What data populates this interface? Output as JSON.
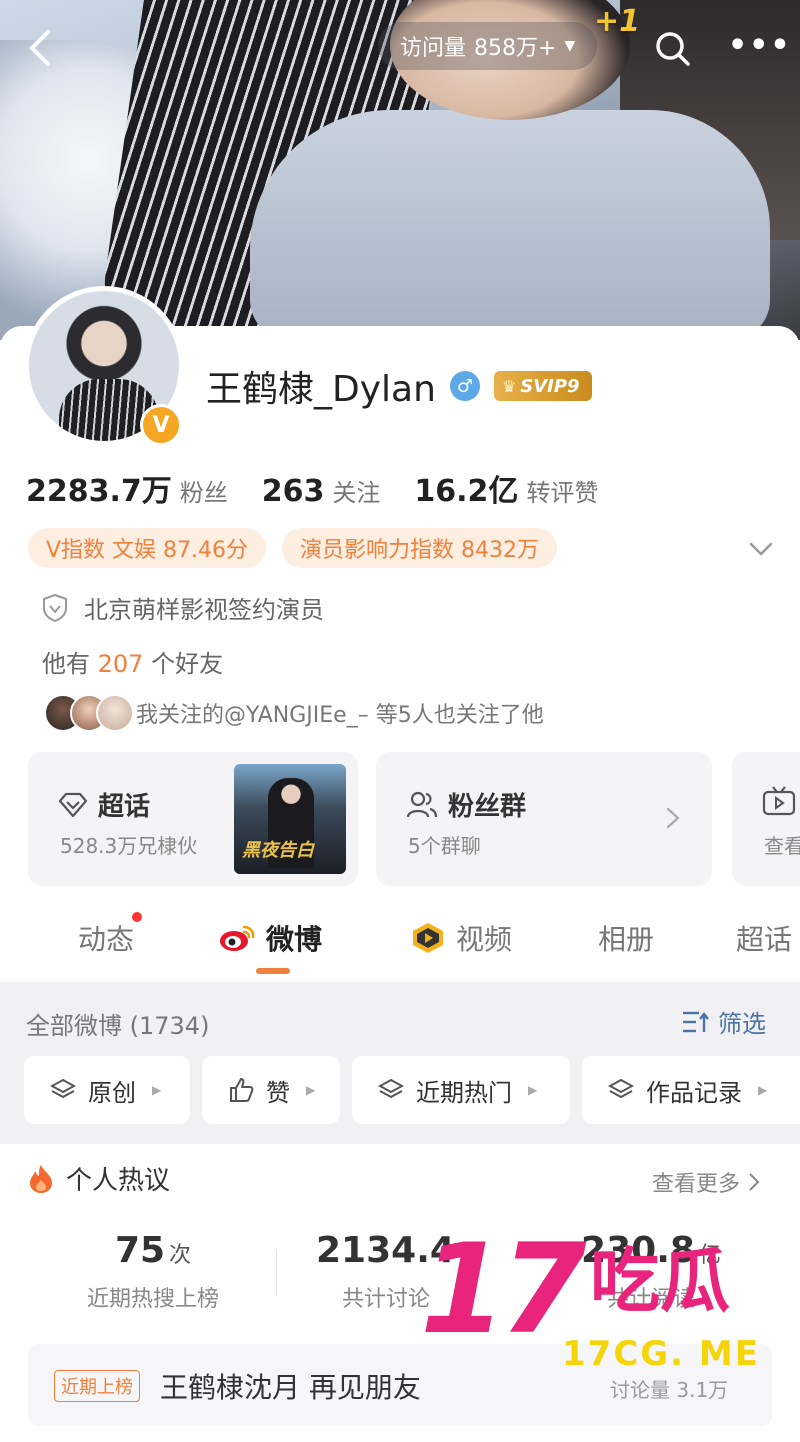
{
  "header": {
    "visits_label": "访问量",
    "visits_value": "858万+",
    "plus_one": "+1"
  },
  "profile": {
    "name": "王鹤棣_Dylan",
    "gender_icon": "male-icon",
    "vip_badge": "SVIP9",
    "verified_badge": "V",
    "stats": [
      {
        "value": "2283.7万",
        "label": "粉丝"
      },
      {
        "value": "263",
        "label": "关注"
      },
      {
        "value": "16.2亿",
        "label": "转评赞"
      }
    ],
    "chips": [
      "V指数 文娱 87.46分",
      "演员影响力指数 8432万"
    ],
    "verification": "北京萌样影视签约演员",
    "friends_prefix": "他有",
    "friends_count": "207",
    "friends_suffix": "个好友",
    "mutual_text": "我关注的@YANGJIEe_– 等5人也关注了他"
  },
  "feature_cards": [
    {
      "title": "超话",
      "subtitle": "528.3万兄棣伙",
      "thumb_text": "黑夜告白"
    },
    {
      "title": "粉丝群",
      "subtitle": "5个群聊"
    },
    {
      "title": "",
      "subtitle": "查看"
    }
  ],
  "tabs": [
    {
      "label": "动态",
      "has_dot": true
    },
    {
      "label": "微博",
      "active": true
    },
    {
      "label": "视频"
    },
    {
      "label": "相册"
    },
    {
      "label": "超话"
    }
  ],
  "feed": {
    "all_label": "全部微博 (1734)",
    "filter_label": "筛选",
    "pills": [
      "原创",
      "赞",
      "近期热门",
      "作品记录"
    ]
  },
  "hot": {
    "title": "个人热议",
    "more": "查看更多",
    "metrics": [
      {
        "value": "75",
        "unit": "次",
        "label": "近期热搜上榜"
      },
      {
        "value": "2134.4",
        "unit": "",
        "label": "共计讨论"
      },
      {
        "value": "230.8",
        "unit": "亿",
        "label": "共计阅读"
      }
    ],
    "trend_tag": "近期上榜",
    "trend_title": "王鹤棣沈月 再见朋友",
    "trend_value": "讨论量 3.1万"
  },
  "watermark": {
    "big": "17",
    "cn": "吃瓜",
    "url": "17CG. ME"
  },
  "colors": {
    "accent_orange": "#f0803c",
    "link_blue": "#4a74a8",
    "watermark_pink": "#e8247c",
    "watermark_yellow": "#f5d40a"
  }
}
